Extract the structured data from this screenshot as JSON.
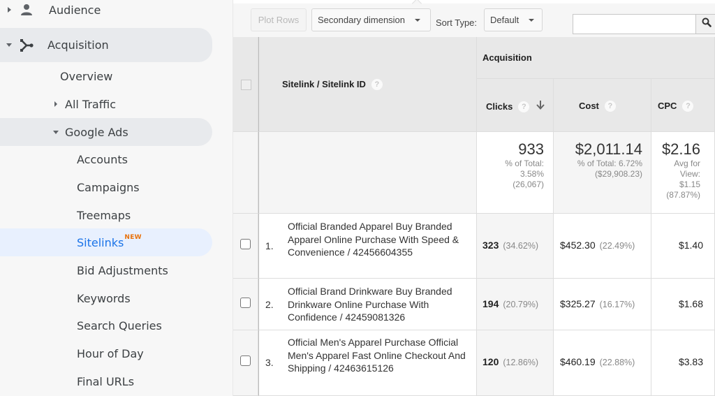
{
  "sidebar": {
    "items": [
      {
        "label": "Audience",
        "icon": "person-icon",
        "caret": "right"
      },
      {
        "label": "Acquisition",
        "icon": "acquisition-icon",
        "caret": "down"
      },
      {
        "label": "Overview"
      },
      {
        "label": "All Traffic",
        "caret": "right"
      },
      {
        "label": "Google Ads",
        "caret": "down"
      },
      {
        "label": "Accounts"
      },
      {
        "label": "Campaigns"
      },
      {
        "label": "Treemaps"
      },
      {
        "label": "Sitelinks",
        "badge": "NEW"
      },
      {
        "label": "Bid Adjustments"
      },
      {
        "label": "Keywords"
      },
      {
        "label": "Search Queries"
      },
      {
        "label": "Hour of Day"
      },
      {
        "label": "Final URLs"
      }
    ],
    "active_color": "#1a73e8",
    "badge_color": "#e8710a"
  },
  "toolbar": {
    "plot_rows": "Plot Rows",
    "secondary_dimension": "Secondary dimension",
    "sort_type_label": "Sort Type:",
    "sort_type_value": "Default",
    "search_value": "",
    "search_icon": "search-icon"
  },
  "table": {
    "dimension_header": "Sitelink / Sitelink ID",
    "group_header": "Acquisition",
    "columns": [
      {
        "label": "Clicks",
        "sorted": "descending"
      },
      {
        "label": "Cost"
      },
      {
        "label": "CPC"
      }
    ],
    "help_glyph": "?",
    "totals": {
      "clicks": {
        "value": "933",
        "line1": "% of Total:",
        "line2": "3.58%",
        "line3": "(26,067)"
      },
      "cost": {
        "value": "$2,011.14",
        "line1": "% of Total: 6.72%",
        "line2": "($29,908.23)"
      },
      "cpc": {
        "value": "$2.16",
        "line1": "Avg for",
        "line2": "View:",
        "line3": "$1.15",
        "line4": "(87.87%)"
      }
    },
    "rows": [
      {
        "index": "1.",
        "sitelink": "Official Branded Apparel Buy Branded Apparel Online Purchase With Speed & Convenience / 42456604355",
        "clicks": "323",
        "clicks_pct": "(34.62%)",
        "cost": "$452.30",
        "cost_pct": "(22.49%)",
        "cpc": "$1.40"
      },
      {
        "index": "2.",
        "sitelink": "Official Brand Drinkware Buy Branded Drinkware Online Purchase With Confidence / 42459081326",
        "clicks": "194",
        "clicks_pct": "(20.79%)",
        "cost": "$325.27",
        "cost_pct": "(16.17%)",
        "cpc": "$1.68"
      },
      {
        "index": "3.",
        "sitelink": "Official Men's Apparel Purchase Official Men's Apparel Fast Online Checkout And Shipping / 42463615126",
        "clicks": "120",
        "clicks_pct": "(12.86%)",
        "cost": "$460.19",
        "cost_pct": "(22.88%)",
        "cpc": "$3.83"
      }
    ]
  }
}
